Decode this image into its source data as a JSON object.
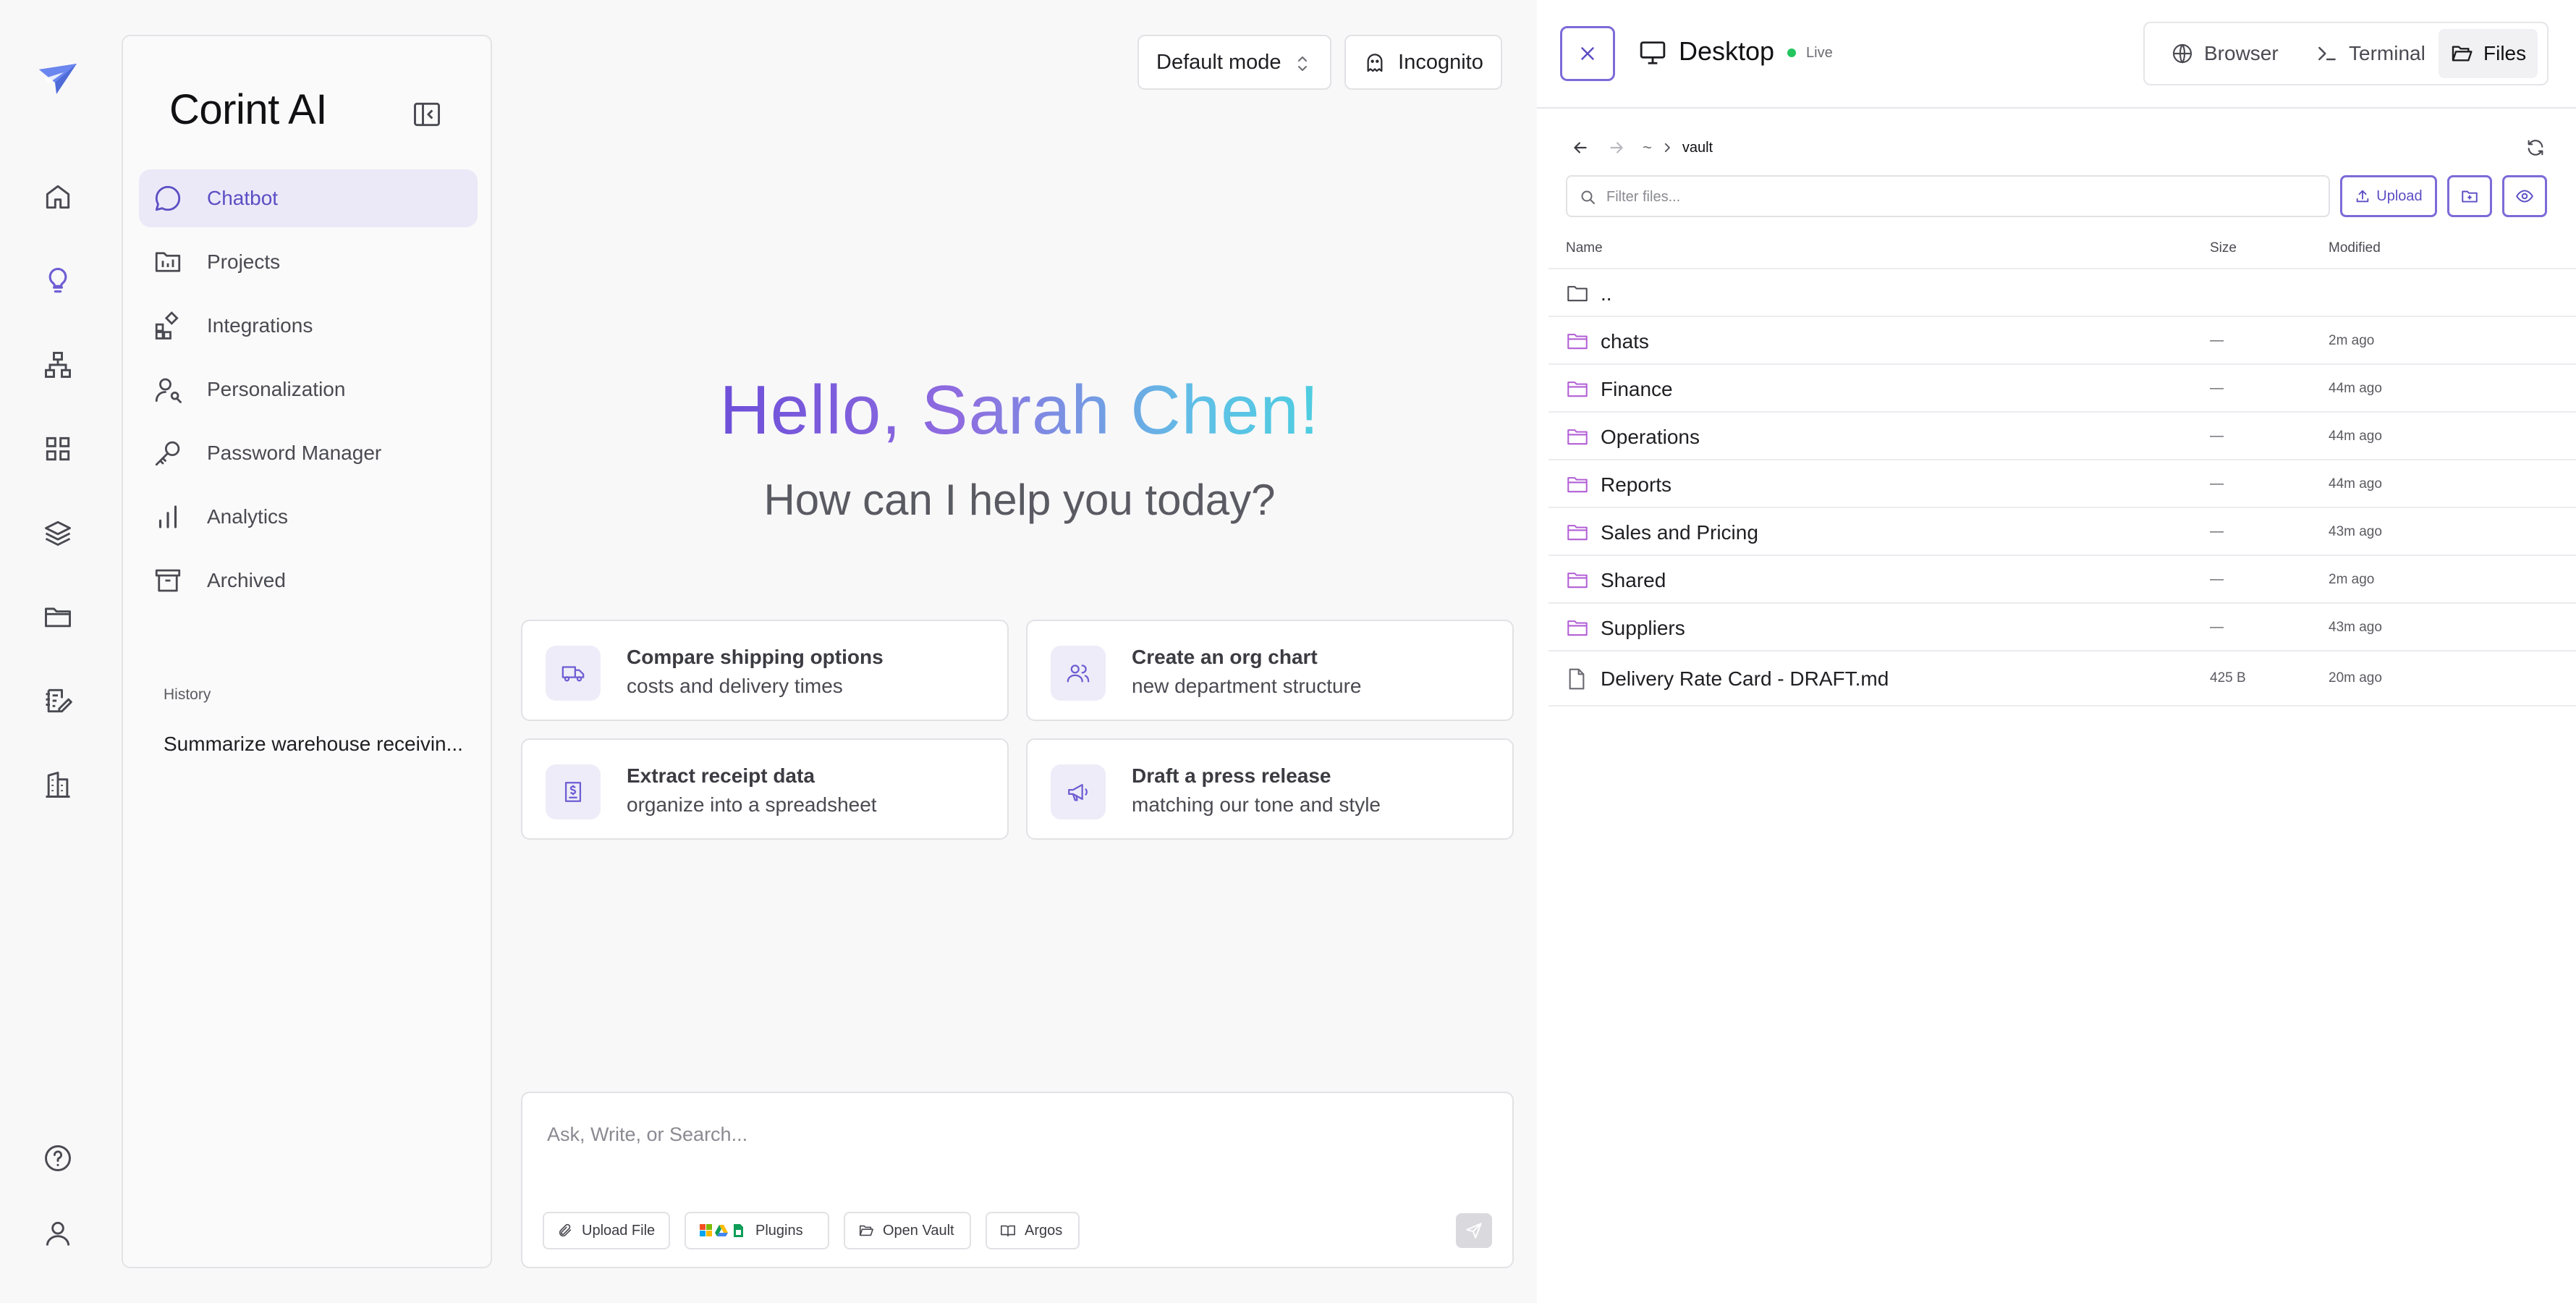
{
  "app": {
    "brand": "Corint AI"
  },
  "rail": {
    "items": [
      "home-icon",
      "lightbulb-icon",
      "org-chart-icon",
      "apps-grid-icon",
      "layers-icon",
      "folder-icon",
      "notes-edit-icon",
      "building-icon"
    ],
    "bottom": [
      "help-icon",
      "user-icon"
    ]
  },
  "sidebar": {
    "items": [
      {
        "label": "Chatbot",
        "icon": "chat-bubble-icon",
        "active": true
      },
      {
        "label": "Projects",
        "icon": "projects-icon"
      },
      {
        "label": "Integrations",
        "icon": "integrations-icon"
      },
      {
        "label": "Personalization",
        "icon": "personalization-icon"
      },
      {
        "label": "Password Manager",
        "icon": "key-icon"
      },
      {
        "label": "Analytics",
        "icon": "analytics-icon"
      },
      {
        "label": "Archived",
        "icon": "archive-icon"
      }
    ],
    "history_label": "History",
    "history": [
      "Summarize warehouse receivin..."
    ]
  },
  "topbar": {
    "mode": "Default mode",
    "incognito": "Incognito"
  },
  "main": {
    "greeting": "Hello, Sarah Chen!",
    "subtitle": "How can I help you today?",
    "cards": [
      {
        "title": "Compare shipping options",
        "detail": "costs and delivery times",
        "icon": "truck-icon"
      },
      {
        "title": "Create an org chart",
        "detail": "new department structure",
        "icon": "users-icon"
      },
      {
        "title": "Extract receipt data",
        "detail": "organize into a spreadsheet",
        "icon": "receipt-icon"
      },
      {
        "title": "Draft a press release",
        "detail": "matching our tone and style",
        "icon": "megaphone-icon"
      }
    ]
  },
  "composer": {
    "placeholder": "Ask, Write, or Search...",
    "chips": [
      "Upload File",
      "Plugins",
      "Open Vault",
      "Argos"
    ]
  },
  "panel": {
    "title": "Desktop",
    "status": "Live",
    "tabs": [
      {
        "label": "Browser",
        "icon": "globe-icon"
      },
      {
        "label": "Terminal",
        "icon": "terminal-icon"
      },
      {
        "label": "Files",
        "icon": "folder-open-icon",
        "active": true
      }
    ],
    "breadcrumb": {
      "root": "~",
      "current": "vault"
    },
    "filter_placeholder": "Filter files...",
    "upload_label": "Upload",
    "columns": {
      "name": "Name",
      "size": "Size",
      "modified": "Modified"
    },
    "rows": [
      {
        "name": "..",
        "size": "",
        "modified": "",
        "type": "parent"
      },
      {
        "name": "chats",
        "size": "—",
        "modified": "2m ago",
        "type": "folder"
      },
      {
        "name": "Finance",
        "size": "—",
        "modified": "44m ago",
        "type": "folder"
      },
      {
        "name": "Operations",
        "size": "—",
        "modified": "44m ago",
        "type": "folder"
      },
      {
        "name": "Reports",
        "size": "—",
        "modified": "44m ago",
        "type": "folder"
      },
      {
        "name": "Sales and Pricing",
        "size": "—",
        "modified": "43m ago",
        "type": "folder"
      },
      {
        "name": "Shared",
        "size": "—",
        "modified": "2m ago",
        "type": "folder"
      },
      {
        "name": "Suppliers",
        "size": "—",
        "modified": "43m ago",
        "type": "folder"
      },
      {
        "name": "Delivery Rate Card - DRAFT.md",
        "size": "425 B",
        "modified": "20m ago",
        "type": "file"
      }
    ]
  },
  "colors": {
    "accent": "#6d5dd3",
    "accent_bg": "#ebe9f8",
    "live": "#22c55e",
    "folder": "#b25fd6"
  }
}
